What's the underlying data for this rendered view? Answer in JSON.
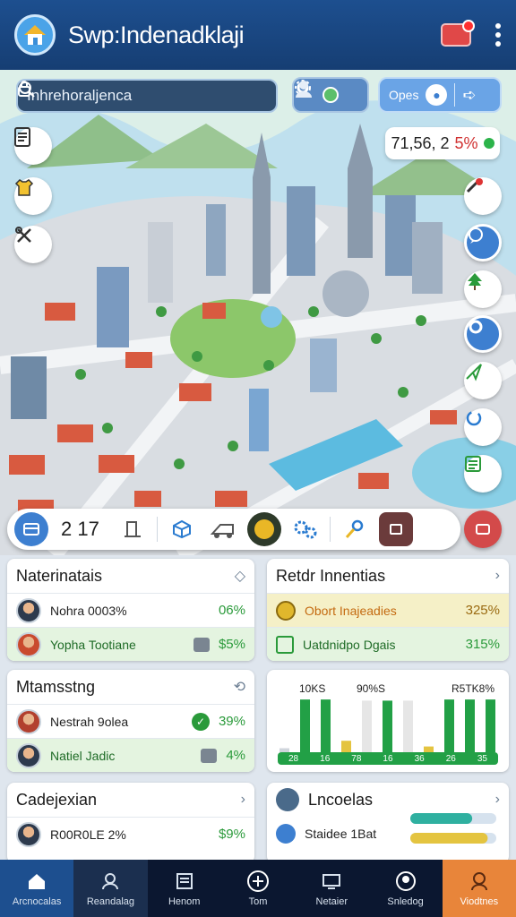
{
  "app": {
    "title": "Swp:Indenadklaji"
  },
  "search": {
    "placeholder": "Inhrehoraljenca"
  },
  "open_button": {
    "label": "Opes"
  },
  "coordinates": {
    "value": "71,56, 2",
    "accent": "5%"
  },
  "toolbar": {
    "count": "2 17"
  },
  "cards": {
    "card1": {
      "title": "Naterinatais",
      "rows": [
        {
          "name": "Nohra 0003%",
          "pct": "06%"
        },
        {
          "name": "Yopha Tootiane",
          "pct": "$5%"
        }
      ]
    },
    "card2": {
      "title": "Retdr Innentias",
      "rows": [
        {
          "name": "Obort Inajeadies",
          "pct": "325%"
        },
        {
          "name": "Uatdnidpo Dgais",
          "pct": "315%"
        }
      ]
    },
    "card3": {
      "title": "Mtamsstng",
      "rows": [
        {
          "name": "Nestrah 9olea",
          "pct": "39%"
        },
        {
          "name": "Natiel Jadic",
          "pct": "4%"
        }
      ]
    },
    "card4": {
      "bar_labels": [
        "10KS",
        "90%S",
        "R5TK8%"
      ],
      "axis_labels": [
        "28",
        "16",
        "78",
        "16",
        "36",
        "26",
        "35"
      ],
      "bars": [
        {
          "value": 0.07,
          "color": "#cfd5dc"
        },
        {
          "value": 0.92,
          "color": "#22a046"
        },
        {
          "value": 0.92,
          "color": "#22a046"
        },
        {
          "value": 0.2,
          "color": "#e4c440"
        },
        {
          "value": 0.9,
          "color": "#e6e6e6"
        },
        {
          "value": 0.9,
          "color": "#22a046"
        },
        {
          "value": 0.9,
          "color": "#e6e6e6"
        },
        {
          "value": 0.1,
          "color": "#e4c440"
        },
        {
          "value": 0.92,
          "color": "#22a046"
        },
        {
          "value": 0.92,
          "color": "#22a046"
        },
        {
          "value": 0.92,
          "color": "#22a046"
        }
      ]
    },
    "card5": {
      "title": "Cadejexian",
      "rows": [
        {
          "name": "R00R0LE 2%",
          "pct": "$9%"
        }
      ]
    },
    "card6": {
      "title": "Lncoelas",
      "rows": [
        {
          "name": "Staidee 1Bat"
        }
      ],
      "bars": [
        {
          "value": 0.72,
          "color": "#2fb0a0"
        },
        {
          "value": 0.9,
          "color": "#e4c440"
        }
      ]
    }
  },
  "nav": {
    "items": [
      {
        "label": "Arcnocalas"
      },
      {
        "label": "Reandalag"
      },
      {
        "label": "Henom"
      },
      {
        "label": "Tom"
      },
      {
        "label": "Netaier"
      },
      {
        "label": "Snledog"
      },
      {
        "label": "Viodtnes"
      }
    ]
  },
  "colors": {
    "header": "#1d4f8f",
    "accent_green": "#22a046",
    "accent_orange": "#e8853a"
  }
}
